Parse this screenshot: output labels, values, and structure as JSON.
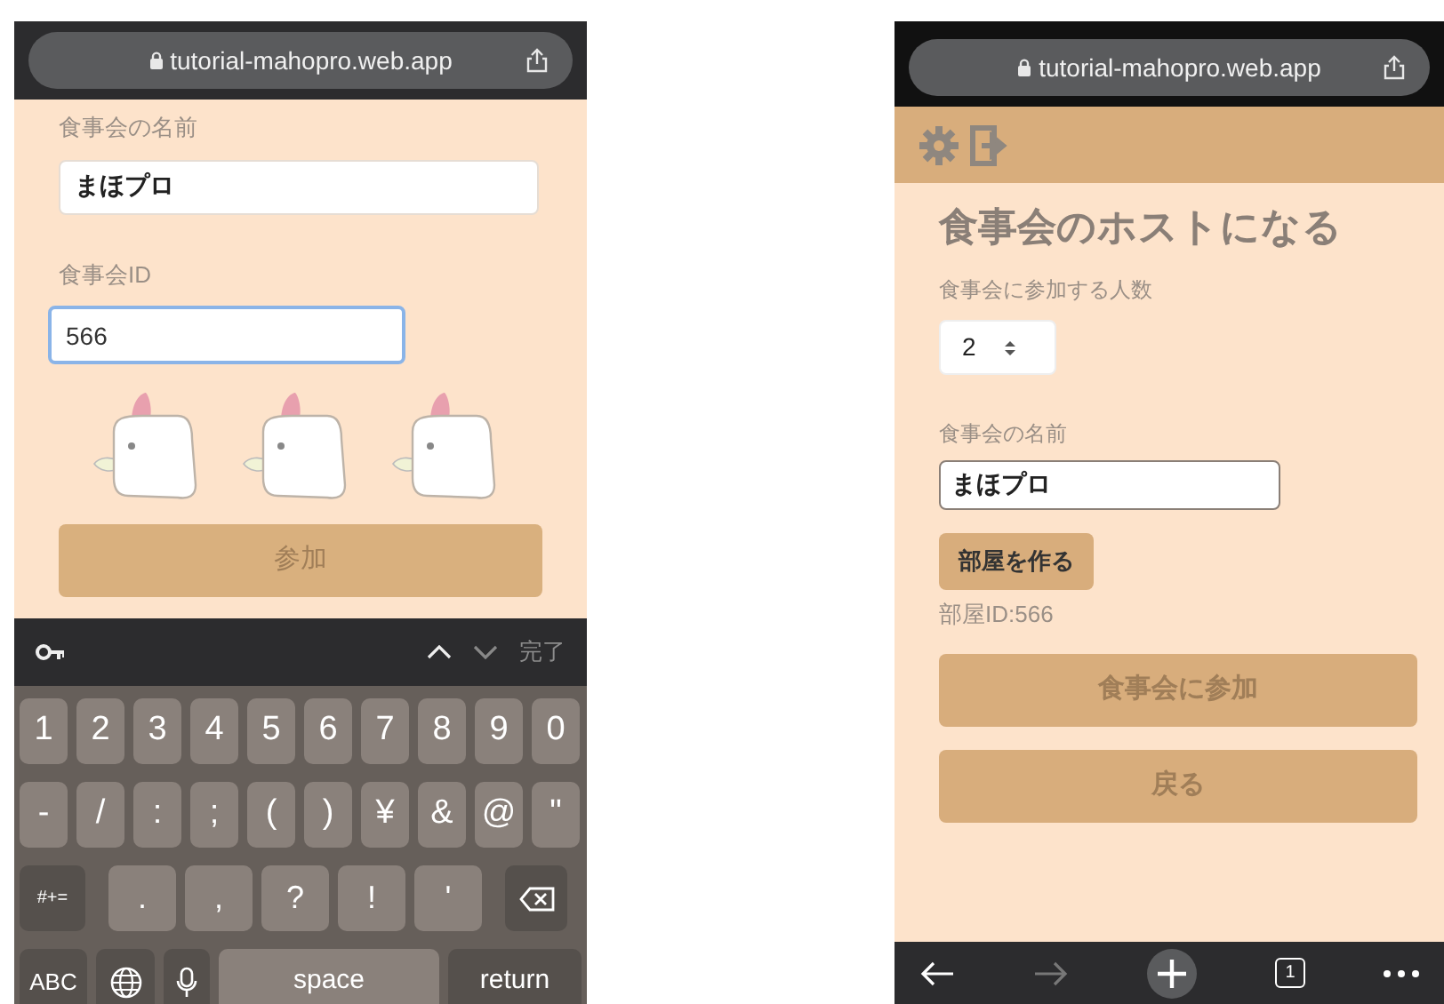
{
  "join_screen": {
    "url": "tutorial-mahopro.web.app",
    "fields": [
      {
        "label": "食事会の名前",
        "value": "まほプロ",
        "focused": false
      },
      {
        "label": "食事会ID",
        "value": "566",
        "focused": true
      }
    ],
    "button": "参加",
    "keyboard": {
      "done": "完了",
      "rows": [
        {
          "keys": [
            {
              "kind": "char",
              "label": "1"
            },
            {
              "kind": "char",
              "label": "2"
            },
            {
              "kind": "char",
              "label": "3"
            },
            {
              "kind": "char",
              "label": "4"
            },
            {
              "kind": "char",
              "label": "5"
            },
            {
              "kind": "char",
              "label": "6"
            },
            {
              "kind": "char",
              "label": "7"
            },
            {
              "kind": "char",
              "label": "8"
            },
            {
              "kind": "char",
              "label": "9"
            },
            {
              "kind": "char",
              "label": "0"
            }
          ]
        },
        {
          "keys": [
            {
              "kind": "char",
              "label": "-"
            },
            {
              "kind": "char",
              "label": "/"
            },
            {
              "kind": "char",
              "label": ":"
            },
            {
              "kind": "char",
              "label": ";"
            },
            {
              "kind": "char",
              "label": "("
            },
            {
              "kind": "char",
              "label": ")"
            },
            {
              "kind": "char",
              "label": "¥"
            },
            {
              "kind": "char",
              "label": "&"
            },
            {
              "kind": "char",
              "label": "@"
            },
            {
              "kind": "char",
              "label": "\""
            }
          ]
        },
        {
          "keys": [
            {
              "kind": "function",
              "label": "#+="
            },
            {
              "kind": "punct",
              "label": "."
            },
            {
              "kind": "punct",
              "label": ","
            },
            {
              "kind": "punct",
              "label": "?"
            },
            {
              "kind": "punct",
              "label": "!"
            },
            {
              "kind": "punct",
              "label": "'"
            },
            {
              "kind": "backspace"
            }
          ]
        },
        {
          "keys": [
            {
              "kind": "function",
              "label": "ABC"
            },
            {
              "kind": "globe"
            },
            {
              "kind": "mic"
            },
            {
              "kind": "space",
              "label": "space"
            },
            {
              "kind": "return",
              "label": "return"
            }
          ]
        }
      ]
    }
  },
  "host_screen": {
    "url": "tutorial-mahopro.web.app",
    "title": "食事会のホストになる",
    "count": {
      "label": "食事会に参加する人数",
      "value": "2"
    },
    "name": {
      "label": "食事会の名前",
      "value": "まほプロ"
    },
    "create_button": "部屋を作る",
    "room_id": "部屋ID:566",
    "buttons": [
      "食事会に参加",
      "戻る"
    ],
    "toolbar": {
      "forward_disabled": true,
      "tab_count": "1"
    }
  }
}
